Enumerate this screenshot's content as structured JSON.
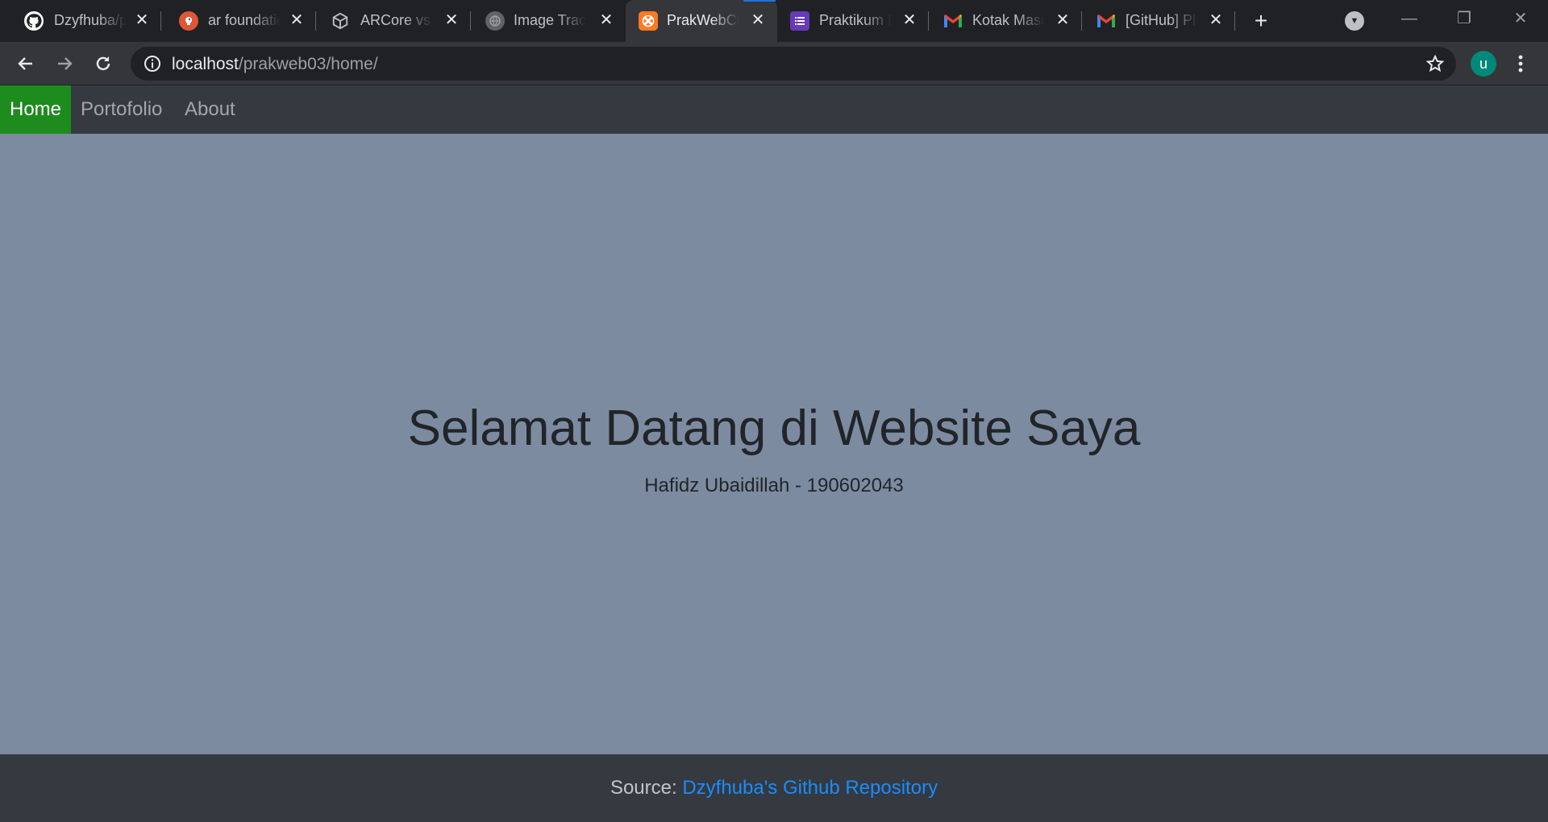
{
  "browser": {
    "tabs": [
      {
        "title": "Dzyfhuba/pra",
        "icon": "github-icon",
        "active": false
      },
      {
        "title": "ar foundation",
        "icon": "duckduckgo-icon",
        "active": false
      },
      {
        "title": "ARCore vs AR",
        "icon": "unity-icon",
        "active": false
      },
      {
        "title": "Image Tracki",
        "icon": "globe-icon",
        "active": false
      },
      {
        "title": "PrakWebCP",
        "icon": "xampp-icon",
        "active": true
      },
      {
        "title": "Praktikum Pr",
        "icon": "list-icon",
        "active": false
      },
      {
        "title": "Kotak Masuk",
        "icon": "gmail-icon",
        "active": false
      },
      {
        "title": "[GitHub] Ple",
        "icon": "gmail-icon",
        "active": false
      }
    ],
    "new_tab": "+",
    "address": {
      "host": "localhost",
      "path": "/prakweb03/home/"
    },
    "profile_initial": "u"
  },
  "site": {
    "nav": [
      {
        "label": "Home",
        "active": true
      },
      {
        "label": "Portofolio",
        "active": false
      },
      {
        "label": "About",
        "active": false
      }
    ],
    "hero": {
      "title": "Selamat Datang di Website Saya",
      "subtitle": "Hafidz Ubaidillah - 190602043"
    },
    "footer": {
      "prefix": "Source: ",
      "link": "Dzyfhuba's Github Repository"
    }
  },
  "colors": {
    "hero_bg": "#7d8ba1",
    "nav_bg": "#343a40",
    "nav_active": "#1e8b1e",
    "link": "#1a8cff",
    "profile": "#00897b"
  }
}
